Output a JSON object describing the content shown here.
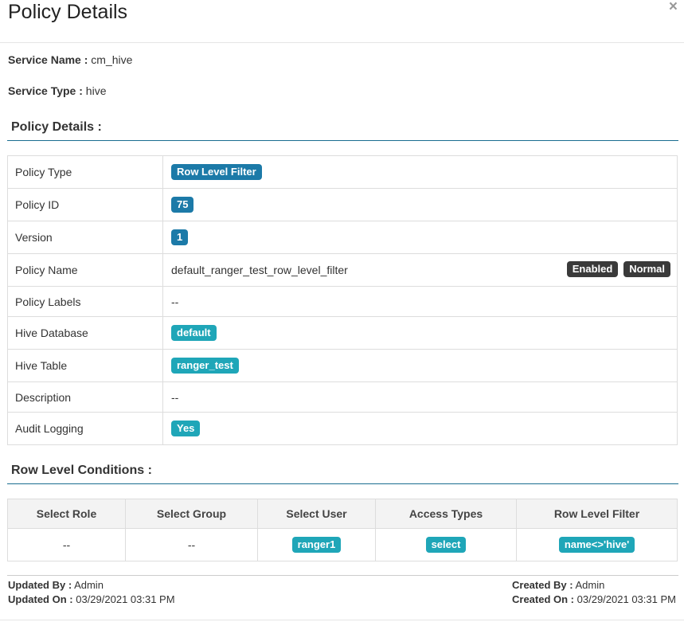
{
  "header": {
    "title": "Policy Details",
    "close_icon": "×"
  },
  "service": {
    "name_label": "Service Name :",
    "name_value": "cm_hive",
    "type_label": "Service Type :",
    "type_value": "hive"
  },
  "policy_section": {
    "title": "Policy Details :",
    "rows": [
      {
        "label": "Policy Type",
        "value": "Row Level Filter"
      },
      {
        "label": "Policy ID",
        "value": "75"
      },
      {
        "label": "Version",
        "value": "1"
      },
      {
        "label": "Policy Name",
        "value": "default_ranger_test_row_level_filter",
        "status_badges": [
          "Enabled",
          "Normal"
        ]
      },
      {
        "label": "Policy Labels",
        "value": "--"
      },
      {
        "label": "Hive Database",
        "value": "default"
      },
      {
        "label": "Hive Table",
        "value": "ranger_test"
      },
      {
        "label": "Description",
        "value": "--"
      },
      {
        "label": "Audit Logging",
        "value": "Yes"
      }
    ]
  },
  "conditions_section": {
    "title": "Row Level Conditions :",
    "headers": [
      "Select Role",
      "Select Group",
      "Select User",
      "Access Types",
      "Row Level Filter"
    ],
    "rows": [
      {
        "role": "--",
        "group": "--",
        "user": "ranger1",
        "access": "select",
        "filter": "name<>'hive'"
      }
    ]
  },
  "footer": {
    "updated_by_label": "Updated By :",
    "updated_by": "Admin",
    "updated_on_label": "Updated On :",
    "updated_on": "03/29/2021 03:31 PM",
    "created_by_label": "Created By :",
    "created_by": "Admin",
    "created_on_label": "Created On :",
    "created_on": "03/29/2021 03:31 PM"
  },
  "colors": {
    "badge_blue": "#1c7aa8",
    "badge_teal": "#1fa6b8",
    "badge_dark": "#3a3a3a",
    "section_rule": "#1a6d90"
  }
}
